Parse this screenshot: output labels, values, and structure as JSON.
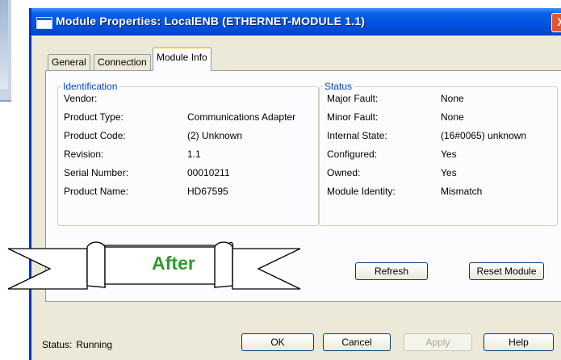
{
  "window": {
    "title": "Module Properties: LocalENB (ETHERNET-MODULE 1.1)",
    "close_glyph": "X"
  },
  "tabs": [
    {
      "label": "General"
    },
    {
      "label": "Connection"
    },
    {
      "label": "Module Info",
      "active": true
    }
  ],
  "identification": {
    "legend": "Identification",
    "rows": [
      {
        "label": "Vendor:",
        "value": ""
      },
      {
        "label": "Product Type:",
        "value": "Communications Adapter"
      },
      {
        "label": "Product Code:",
        "value": "(2) Unknown"
      },
      {
        "label": "Revision:",
        "value": "1.1"
      },
      {
        "label": "Serial Number:",
        "value": "00010211"
      },
      {
        "label": "Product Name:",
        "value": "HD67595"
      }
    ]
  },
  "status_group": {
    "legend": "Status",
    "rows": [
      {
        "label": "Major Fault:",
        "value": "None"
      },
      {
        "label": "Minor Fault:",
        "value": "None"
      },
      {
        "label": "Internal State:",
        "value": "(16#0065) unknown"
      },
      {
        "label": "Configured:",
        "value": "Yes"
      },
      {
        "label": "Owned:",
        "value": "Yes"
      },
      {
        "label": "Module Identity:",
        "value": "Mismatch"
      }
    ]
  },
  "banner": {
    "text": "After"
  },
  "actions": {
    "refresh": "Refresh",
    "reset_module": "Reset Module"
  },
  "footer": {
    "status_label": "Status:",
    "status_value": "Running",
    "ok": "OK",
    "cancel": "Cancel",
    "apply": "Apply",
    "help": "Help"
  },
  "colors": {
    "titlebar": "#0054e3",
    "legend_text": "#0046d5",
    "banner_text": "#2e9a2e",
    "dialog_bg": "#ece9d8"
  }
}
